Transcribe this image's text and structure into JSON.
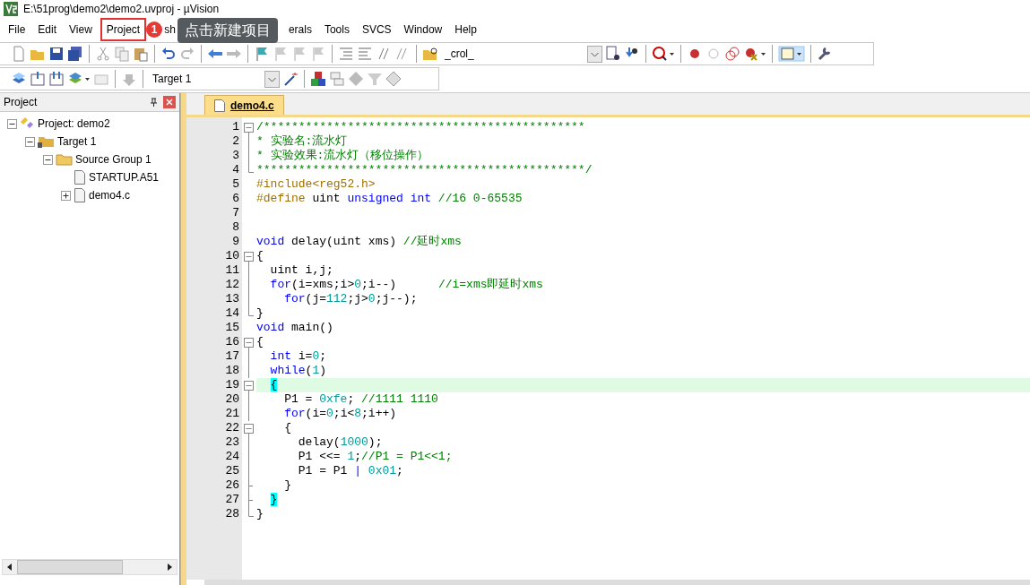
{
  "window": {
    "title": "E:\\51prog\\demo2\\demo2.uvproj - µVision"
  },
  "menu": [
    {
      "label": "File",
      "highlighted": false
    },
    {
      "label": "Edit",
      "highlighted": false
    },
    {
      "label": "View",
      "highlighted": false
    },
    {
      "label": "Project",
      "highlighted": true
    },
    {
      "label": "sh",
      "highlighted": false
    },
    {
      "label": "erals",
      "highlighted": false
    },
    {
      "label": "Tools",
      "highlighted": false
    },
    {
      "label": "SVCS",
      "highlighted": false
    },
    {
      "label": "Window",
      "highlighted": false
    },
    {
      "label": "Help",
      "highlighted": false
    }
  ],
  "callout": {
    "badge": "1",
    "text": "点击新建项目"
  },
  "toolbar": {
    "find_combo": "_crol_",
    "target_combo": "Target 1"
  },
  "project_panel": {
    "title": "Project",
    "tree": [
      {
        "label": "Project: demo2",
        "kind": "project",
        "expanded": true,
        "children": [
          {
            "label": "Target 1",
            "kind": "target",
            "expanded": true,
            "children": [
              {
                "label": "Source Group 1",
                "kind": "group",
                "expanded": true,
                "children": [
                  {
                    "label": "STARTUP.A51",
                    "kind": "file"
                  },
                  {
                    "label": "demo4.c",
                    "kind": "file",
                    "expanded": false
                  }
                ]
              }
            ]
          }
        ]
      }
    ]
  },
  "editor": {
    "tabs": [
      {
        "label": "demo4.c",
        "selected": true
      }
    ],
    "lines": [
      {
        "number": "1",
        "kind": "box",
        "current": false,
        "tokens": [
          {
            "kind": "comment",
            "text": "/**********************************************"
          }
        ]
      },
      {
        "number": "2",
        "kind": "bar",
        "current": false,
        "tokens": [
          {
            "kind": "comment",
            "text": "* 实验名:流水灯"
          }
        ]
      },
      {
        "number": "3",
        "kind": "bar",
        "current": false,
        "tokens": [
          {
            "kind": "comment",
            "text": "* 实验效果:流水灯（移位操作）"
          }
        ]
      },
      {
        "number": "4",
        "kind": "end",
        "current": false,
        "tokens": [
          {
            "kind": "comment",
            "text": "***********************************************/"
          }
        ]
      },
      {
        "number": "5",
        "current": false,
        "tokens": [
          {
            "kind": "preproc",
            "text": "#include<reg52.h>"
          }
        ]
      },
      {
        "number": "6",
        "current": false,
        "tokens": [
          {
            "kind": "preproc",
            "text": "#define"
          },
          {
            "kind": "plain",
            "text": " uint "
          },
          {
            "kind": "keyword",
            "text": "unsigned"
          },
          {
            "kind": "keyword",
            "text": " int"
          },
          {
            "kind": "comment",
            "text": " //16 0-65535"
          }
        ]
      },
      {
        "number": "7",
        "current": false
      },
      {
        "number": "8",
        "current": false
      },
      {
        "number": "9",
        "current": false,
        "tokens": [
          {
            "kind": "keyword",
            "text": "void"
          },
          {
            "kind": "plain",
            "text": " delay(uint xms) "
          },
          {
            "kind": "comment",
            "text": "//延时xms"
          }
        ]
      },
      {
        "number": "10",
        "kind": "box",
        "current": false,
        "tokens": [
          {
            "kind": "plain",
            "text": "{"
          }
        ]
      },
      {
        "number": "11",
        "kind": "bar",
        "current": false,
        "tokens": [
          {
            "kind": "plain",
            "text": "  uint i,j;"
          }
        ]
      },
      {
        "number": "12",
        "kind": "bar",
        "current": false,
        "tokens": [
          {
            "kind": "keyword",
            "text": "  for"
          },
          {
            "kind": "plain",
            "text": "(i=xms;i>"
          },
          {
            "kind": "number",
            "text": "0"
          },
          {
            "kind": "plain",
            "text": ";i--)      "
          },
          {
            "kind": "comment",
            "text": "//i=xms即延时xms"
          }
        ]
      },
      {
        "number": "13",
        "kind": "bar",
        "current": false,
        "tokens": [
          {
            "kind": "keyword",
            "text": "    for"
          },
          {
            "kind": "plain",
            "text": "(j="
          },
          {
            "kind": "number",
            "text": "112"
          },
          {
            "kind": "plain",
            "text": ";j>"
          },
          {
            "kind": "number",
            "text": "0"
          },
          {
            "kind": "plain",
            "text": ";j--);"
          }
        ]
      },
      {
        "number": "14",
        "kind": "end",
        "current": false,
        "tokens": [
          {
            "kind": "plain",
            "text": "}"
          }
        ]
      },
      {
        "number": "15",
        "current": false,
        "tokens": [
          {
            "kind": "keyword",
            "text": "void"
          },
          {
            "kind": "plain",
            "text": " main()"
          }
        ]
      },
      {
        "number": "16",
        "kind": "box",
        "current": false,
        "tokens": [
          {
            "kind": "plain",
            "text": "{"
          }
        ]
      },
      {
        "number": "17",
        "kind": "bar",
        "current": false,
        "tokens": [
          {
            "kind": "keyword",
            "text": "  int"
          },
          {
            "kind": "plain",
            "text": " i="
          },
          {
            "kind": "number",
            "text": "0"
          },
          {
            "kind": "plain",
            "text": ";"
          }
        ]
      },
      {
        "number": "18",
        "kind": "bar",
        "current": false,
        "tokens": [
          {
            "kind": "keyword",
            "text": "  while"
          },
          {
            "kind": "plain",
            "text": "("
          },
          {
            "kind": "number",
            "text": "1"
          },
          {
            "kind": "plain",
            "text": ")"
          }
        ]
      },
      {
        "number": "19",
        "kind": "box",
        "current": true,
        "tokens": [
          {
            "kind": "match",
            "text": "  {"
          }
        ]
      },
      {
        "number": "20",
        "kind": "bar",
        "current": false,
        "tokens": [
          {
            "kind": "plain",
            "text": "    P1 = "
          },
          {
            "kind": "number",
            "text": "0xfe"
          },
          {
            "kind": "plain",
            "text": "; "
          },
          {
            "kind": "comment",
            "text": "//1111 1110"
          }
        ]
      },
      {
        "number": "21",
        "kind": "bar",
        "current": false,
        "tokens": [
          {
            "kind": "keyword",
            "text": "    for"
          },
          {
            "kind": "plain",
            "text": "(i="
          },
          {
            "kind": "number",
            "text": "0"
          },
          {
            "kind": "plain",
            "text": ";i<"
          },
          {
            "kind": "number",
            "text": "8"
          },
          {
            "kind": "plain",
            "text": ";i++)"
          }
        ]
      },
      {
        "number": "22",
        "kind": "box",
        "current": false,
        "tokens": [
          {
            "kind": "plain",
            "text": "    {"
          }
        ]
      },
      {
        "number": "23",
        "kind": "bar",
        "current": false,
        "tokens": [
          {
            "kind": "plain",
            "text": "      delay("
          },
          {
            "kind": "number",
            "text": "1000"
          },
          {
            "kind": "plain",
            "text": ");"
          }
        ]
      },
      {
        "number": "24",
        "kind": "bar",
        "current": false,
        "tokens": [
          {
            "kind": "plain",
            "text": "      P1 <<= "
          },
          {
            "kind": "number",
            "text": "1"
          },
          {
            "kind": "plain",
            "text": ";"
          },
          {
            "kind": "comment",
            "text": "//P1 = P1<<1;"
          }
        ]
      },
      {
        "number": "25",
        "kind": "bar",
        "current": false,
        "tokens": [
          {
            "kind": "plain",
            "text": "      P1 = P1 "
          },
          {
            "kind": "keyword",
            "text": "|"
          },
          {
            "kind": "number",
            "text": " 0x01"
          },
          {
            "kind": "plain",
            "text": ";"
          }
        ]
      },
      {
        "number": "26",
        "kind": "tick",
        "current": false,
        "tokens": [
          {
            "kind": "plain",
            "text": "    }"
          }
        ]
      },
      {
        "number": "27",
        "kind": "tick",
        "current": false,
        "tokens": [
          {
            "kind": "match",
            "text": "  }"
          }
        ]
      },
      {
        "number": "28",
        "kind": "end",
        "current": false,
        "tokens": [
          {
            "kind": "plain",
            "text": "}"
          }
        ]
      }
    ]
  }
}
